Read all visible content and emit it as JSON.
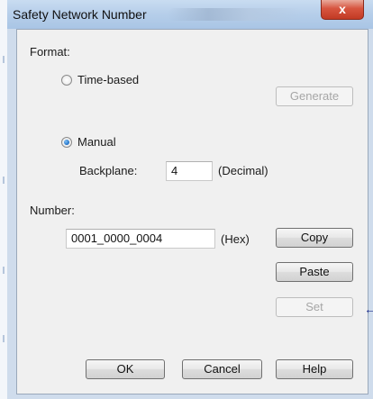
{
  "window": {
    "title": "Safety Network Number",
    "close_glyph": "x",
    "title_blur_icon": "blurred-title-text",
    "close_icon": "close-icon"
  },
  "format": {
    "label": "Format:",
    "time_based_label": "Time-based",
    "time_based_selected": false,
    "manual_label": "Manual",
    "manual_selected": true,
    "generate_label": "Generate",
    "backplane_label": "Backplane:",
    "backplane_value": "4",
    "backplane_unit": "(Decimal)"
  },
  "number": {
    "label": "Number:",
    "value": "0001_0000_0004",
    "unit": "(Hex)"
  },
  "buttons": {
    "copy": "Copy",
    "paste": "Paste",
    "set": "Set",
    "ok": "OK",
    "cancel": "Cancel",
    "help": "Help"
  },
  "annotation": {
    "arrow_glyph": "←",
    "arrow_icon": "left-arrow-icon",
    "arrow_color": "#1a2a8a"
  },
  "colors": {
    "dialog_bg": "#f0f0f0",
    "titlebar": "#b7cfea",
    "close_button": "#c23a24",
    "radio_selected": "#1f6fc6"
  }
}
